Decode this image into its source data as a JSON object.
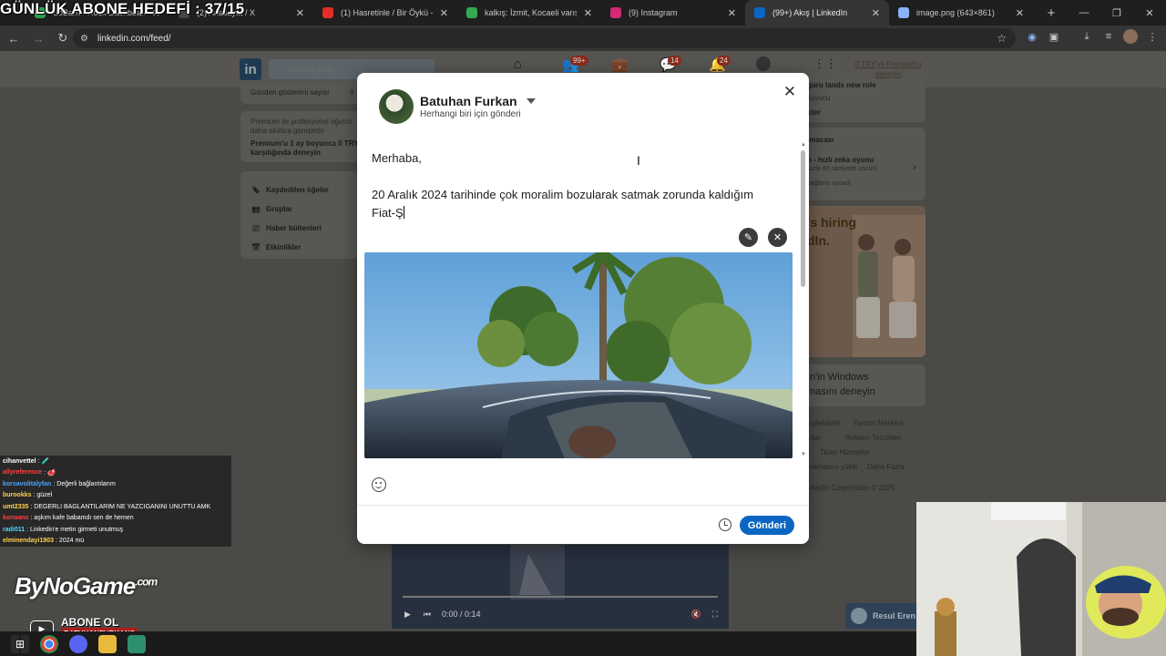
{
  "overlay": {
    "goal_text": "GÜNLÜK ABONE HEDEFİ : 37/15",
    "bynogame_text": "ByNoGame",
    "bynogame_suffix": ".com",
    "subscribe_text": "ABONE OL",
    "subscribe_handle": "BATUHANFURKANS"
  },
  "browser": {
    "tabs": [
      {
        "title": "SoBarn · Rock Dashboard",
        "close": "✕",
        "color": "#2ea34a"
      },
      {
        "title": "(2) Anasayfa / X",
        "close": "✕",
        "color": "#444444"
      },
      {
        "title": "(1) Hasretinle / Bir Öykü - Y",
        "close": "✕",
        "color": "#e52d27"
      },
      {
        "title": "kalkış: İzmit, Kocaeli varış: Mosk",
        "close": "✕",
        "color": "#34a853"
      },
      {
        "title": "(9) Instagram",
        "close": "✕",
        "color": "#d62976"
      },
      {
        "title": "(99+) Akış | LinkedIn",
        "close": "✕",
        "color": "#0a66c2"
      },
      {
        "title": "image.png (643×861)",
        "close": "✕",
        "color": "#8ab4f8"
      }
    ],
    "new_tab": "+",
    "url": "linkedin.com/feed/"
  },
  "linkedin": {
    "search_placeholder": "Arama yap",
    "badges": {
      "network": "99+",
      "messages": "14",
      "notifications": "24"
    },
    "premium_link": "0 TRY'ye Premium'u deneyin",
    "left": {
      "views_label": "Gönderi gösterimi sayısı",
      "views_value": "9",
      "premium_text": "Premium ile profesyonel ağınızı daha akıllıca genişletin",
      "premium_offer": "Premium'u 1 ay boyunca 0 TRY karşılığında deneyin",
      "menu": [
        "Kaydedilen öğeler",
        "Gruplar",
        "Haber bültenleri",
        "Etkinlikler"
      ]
    },
    "right": {
      "news_line1": "guru lands new role",
      "news_line2": "kuyucu",
      "show_more": "ster",
      "game_header": "lmacası",
      "game_title": "p - hızlı zeka oyunu",
      "game_sub": "fazla 60 saniyede çözün!",
      "game_sub2": "bağlantı oynadı",
      "ad_line1": "'s hiring",
      "ad_line2": "dln.",
      "windows_line1": "In'in Windows",
      "windows_line2": "masını deneyin",
      "footer": [
        "rişilebilirlik",
        "Yardım Merkezi",
        "ullar",
        "Reklam Tercihleri",
        "Ticari Hizmetler",
        "ulamasını yükle",
        "Daha Fazla"
      ],
      "copyright": "nkedIn Corporation © 2025"
    },
    "toast_name": "Resul Eren"
  },
  "modal": {
    "author_name": "Batuhan Furkan",
    "visibility": "Herhangi biri için gönderi",
    "text_line1": "Merhaba,",
    "text_line2": "20 Aralık 2024 tarihinde çok moralim bozularak satmak zorunda kaldığım",
    "text_line3": "Fiat-Ş",
    "post_button": "Gönderi"
  },
  "video": {
    "time": "0:00 / 0:14"
  },
  "chat": [
    {
      "user": "cihanvettel",
      "msg": ": 🧪",
      "color": "#ffffff"
    },
    {
      "user": "allyreference",
      "msg": ": 🥩",
      "color": "#ff4040"
    },
    {
      "user": "korsavolitalyfan",
      "msg": ": Değerli bağlantılarım",
      "color": "#4da3ff"
    },
    {
      "user": "burookks",
      "msg": ": güzel",
      "color": "#ffd24d"
    },
    {
      "user": "umt2335",
      "msg": ": DEGERLI BAGLANTILARIM NE YAZCIGANINI UNUTTU AMK",
      "color": "#ffd24d"
    },
    {
      "user": "konaanıı",
      "msg": ": aşkım kafe babamdı sen de hemen",
      "color": "#ff4040"
    },
    {
      "user": "radi011",
      "msg": ": Linkedin'e metin girmeti unutmuş",
      "color": "#4dd9ff"
    },
    {
      "user": "elminendayi1903",
      "msg": ": 2024 mü",
      "color": "#ffd24d"
    }
  ]
}
